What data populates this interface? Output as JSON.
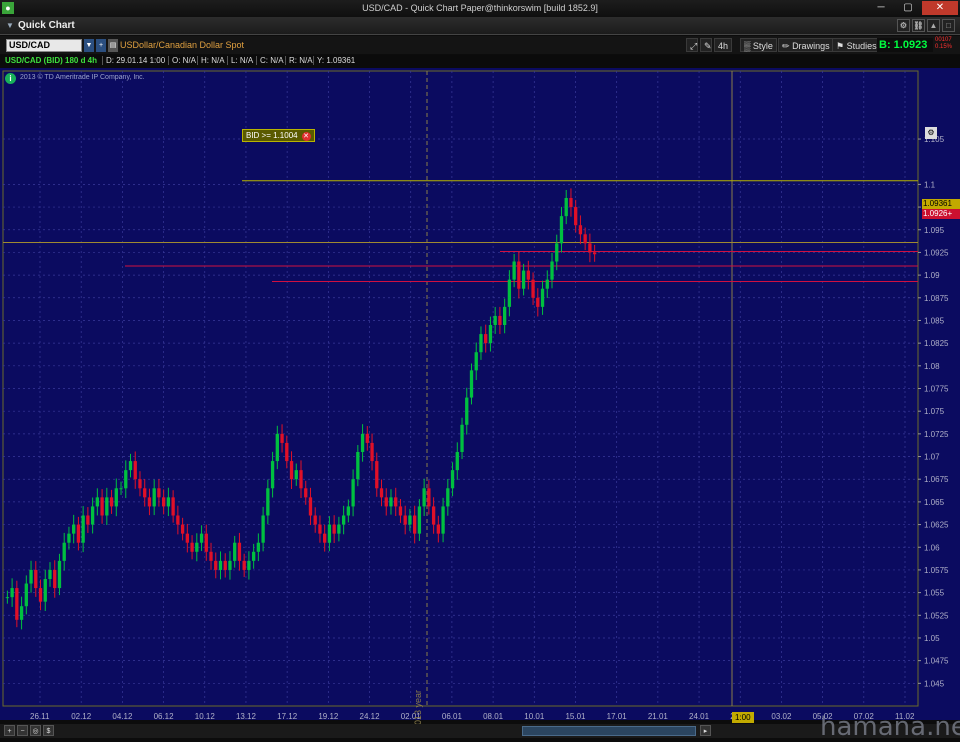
{
  "window": {
    "title": "USD/CAD - Quick Chart Paper@thinkorswim [build 1852.9]",
    "app_icon": "thinkorswim-logo-icon",
    "min_label": "─",
    "max_label": "▢",
    "close_label": "✕"
  },
  "header": {
    "label": "Quick Chart"
  },
  "toolbar": {
    "symbol": "USD/CAD",
    "description": "USDollar/Canadian Dollar Spot",
    "aggregation": "4h",
    "style_label": "Style",
    "drawings_label": "Drawings",
    "studies_label": "Studies",
    "bid": "B: 1.0923",
    "bid_change_1": "00107",
    "bid_change_2": "0.15%"
  },
  "infobar": {
    "symbol_label": "USD/CAD (BID) 180 d 4h",
    "date": "D: 29.01.14 1:00",
    "open": "O: N/A",
    "high": "H: N/A",
    "low": "L: N/A",
    "close": "C: N/A",
    "range": "R: N/A",
    "y": "Y: 1.09361"
  },
  "chart_meta": {
    "copyright": "2013 © TD Ameritrade IP Company, Inc.",
    "alert_label": "BID >= 1.1004",
    "price_tag_1": "1.09361",
    "price_tag_2": "1.0926+",
    "time_marker": "1:00",
    "year_marker": "2013 year",
    "colors": {
      "bg": "#0b0b60",
      "up": "#00c040",
      "down": "#e01028",
      "grid": "#3a3a9a",
      "alert": "#b8b400",
      "level": "#d01040"
    }
  },
  "watermark": "hamana.net",
  "chart_data": {
    "type": "candlestick",
    "title": "",
    "ylim": [
      1.0425,
      1.1125
    ],
    "y_ticks": [
      "1.105",
      "1.1",
      "1.0975",
      "1.095",
      "1.0925",
      "1.09",
      "1.0875",
      "1.085",
      "1.0825",
      "1.08",
      "1.0775",
      "1.075",
      "1.0725",
      "1.07",
      "1.0675",
      "1.065",
      "1.0625",
      "1.06",
      "1.0575",
      "1.055",
      "1.0525",
      "1.05",
      "1.0475",
      "1.045"
    ],
    "x_ticks": [
      "26.11",
      "02.12",
      "04.12",
      "06.12",
      "10.12",
      "13.12",
      "17.12",
      "19.12",
      "24.12",
      "02.01",
      "06.01",
      "08.01",
      "10.01",
      "15.01",
      "17.01",
      "21.01",
      "24.01",
      "28.01",
      "03.02",
      "05.02",
      "07.02",
      "11.02"
    ],
    "close_path": [
      1.0545,
      1.0555,
      1.052,
      1.0535,
      1.056,
      1.0575,
      1.0555,
      1.054,
      1.0565,
      1.0575,
      1.0555,
      1.0585,
      1.0605,
      1.0615,
      1.0625,
      1.0605,
      1.0635,
      1.0625,
      1.0645,
      1.0655,
      1.0635,
      1.0655,
      1.0645,
      1.0665,
      1.0665,
      1.0685,
      1.0695,
      1.0675,
      1.0665,
      1.0655,
      1.0645,
      1.0665,
      1.0655,
      1.0645,
      1.0655,
      1.0635,
      1.0625,
      1.0615,
      1.0605,
      1.0595,
      1.0605,
      1.0615,
      1.0595,
      1.0585,
      1.0575,
      1.0585,
      1.0575,
      1.0585,
      1.0605,
      1.0585,
      1.0575,
      1.0585,
      1.0595,
      1.0605,
      1.0635,
      1.0665,
      1.0695,
      1.0725,
      1.0715,
      1.0695,
      1.0675,
      1.0685,
      1.0665,
      1.0655,
      1.0635,
      1.0625,
      1.0615,
      1.0605,
      1.0625,
      1.0615,
      1.0625,
      1.0635,
      1.0645,
      1.0675,
      1.0705,
      1.0725,
      1.0715,
      1.0695,
      1.0665,
      1.0655,
      1.0645,
      1.0655,
      1.0645,
      1.0635,
      1.0625,
      1.0635,
      1.0615,
      1.0645,
      1.0665,
      1.0645,
      1.0625,
      1.0615,
      1.0645,
      1.0665,
      1.0685,
      1.0705,
      1.0735,
      1.0765,
      1.0795,
      1.0815,
      1.0835,
      1.0825,
      1.0845,
      1.0855,
      1.0845,
      1.0865,
      1.0895,
      1.0915,
      1.0885,
      1.0905,
      1.0895,
      1.0875,
      1.0865,
      1.0885,
      1.0895,
      1.0915,
      1.0935,
      1.0965,
      1.0985,
      1.0975,
      1.0955,
      1.0945,
      1.0935,
      1.0925,
      1.0923
    ]
  }
}
